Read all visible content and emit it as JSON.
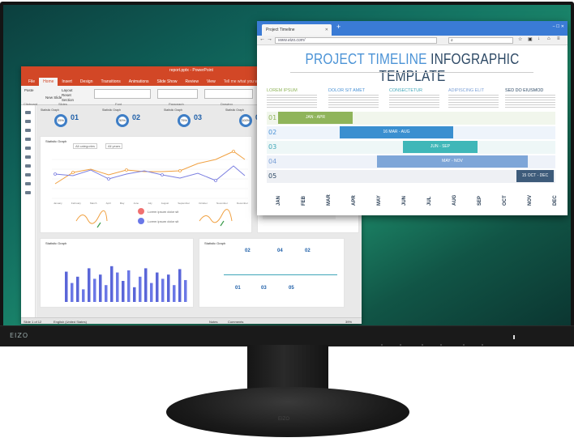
{
  "monitor": {
    "bezel_brand": "EIZO",
    "base_brand": "EIZO",
    "colors": {
      "bezel": "#141414",
      "wallpaper": "#167a66"
    }
  },
  "powerpoint": {
    "window_title": "report.pptx - PowerPoint",
    "tabs": [
      "File",
      "Home",
      "Insert",
      "Design",
      "Transitions",
      "Animations",
      "Slide Show",
      "Review",
      "View"
    ],
    "tell_me": "Tell me what you want to do...",
    "ribbon": {
      "paste": "Paste",
      "new_slide": "New Slide",
      "layout": "Layout",
      "reset": "Reset",
      "section": "Section",
      "groups": [
        "Clipboard",
        "Slides",
        "Font",
        "Paragraph",
        "Drawing"
      ]
    },
    "cards": [
      {
        "title": "Statistic Graph",
        "value": "01",
        "pct": "25%"
      },
      {
        "title": "Statistic Graph",
        "value": "02",
        "pct": "50%"
      },
      {
        "title": "Statistic Graph",
        "value": "03",
        "pct": "75%"
      },
      {
        "title": "Statistic Graph",
        "value": "04",
        "pct": "100%"
      }
    ],
    "line_chart": {
      "title": "Statistic Graph",
      "dropdown_1": "All categories",
      "dropdown_2": "All years",
      "months": [
        "January",
        "February",
        "March",
        "April",
        "May",
        "June",
        "July",
        "August",
        "September",
        "October",
        "November",
        "December"
      ],
      "legend": [
        "Lorem ipsum dolor sit",
        "Lorem ipsum dolor sit"
      ],
      "colors": [
        "#f0a040",
        "#7b7fe0",
        "#f06a6a",
        "#6a78e8"
      ]
    },
    "bottom_left": {
      "title": "Statistic Graph",
      "bars": [
        72,
        45,
        60,
        30,
        80,
        55,
        65,
        40,
        85,
        70,
        50,
        75,
        35,
        60,
        80,
        45,
        70,
        55,
        65,
        40,
        78,
        52
      ]
    },
    "bottom_right": {
      "title": "Statistic Graph",
      "labels": [
        "02",
        "04",
        "02",
        "01",
        "03",
        "05"
      ]
    },
    "status": {
      "slide": "Slide 1 of 12",
      "language": "English (United States)",
      "notes": "Notes",
      "comments": "Comments",
      "zoom": "39%"
    },
    "colors": {
      "accent": "#d24726"
    }
  },
  "browser": {
    "tab_title": "Project Timeline",
    "address": "www.eizo.com/",
    "colors": {
      "chrome": "#3a7bd5"
    },
    "page": {
      "title_a": "PROJECT TIMELINE",
      "title_b": "INFOGRAPHIC TEMPLATE",
      "columns": [
        {
          "head": "LOREM IPSUM",
          "color": "#8fb45a"
        },
        {
          "head": "DOLOR SIT AMET",
          "color": "#4b93d6"
        },
        {
          "head": "CONSECTETUR",
          "color": "#3fa6b8"
        },
        {
          "head": "ADIPISCING ELIT",
          "color": "#7a9fd6"
        },
        {
          "head": "SED DO EIUSMOD",
          "color": "#2e4a66"
        }
      ],
      "rows": [
        {
          "num": "01",
          "label": "JAN - APR",
          "color": "#8fb45a"
        },
        {
          "num": "02",
          "label": "16 MAR - AUG",
          "color": "#3a8fd0"
        },
        {
          "num": "03",
          "label": "JUN - SEP",
          "color": "#3fb7b8"
        },
        {
          "num": "04",
          "label": "MAY - NOV",
          "color": "#7ea6d8"
        },
        {
          "num": "05",
          "label": "15 OCT - DEC",
          "color": "#3d5b7a"
        }
      ],
      "months": [
        "JAN",
        "FEB",
        "MAR",
        "APR",
        "MAY",
        "JUN",
        "JUL",
        "AUG",
        "SEP",
        "OCT",
        "NOV",
        "DEC"
      ]
    }
  }
}
